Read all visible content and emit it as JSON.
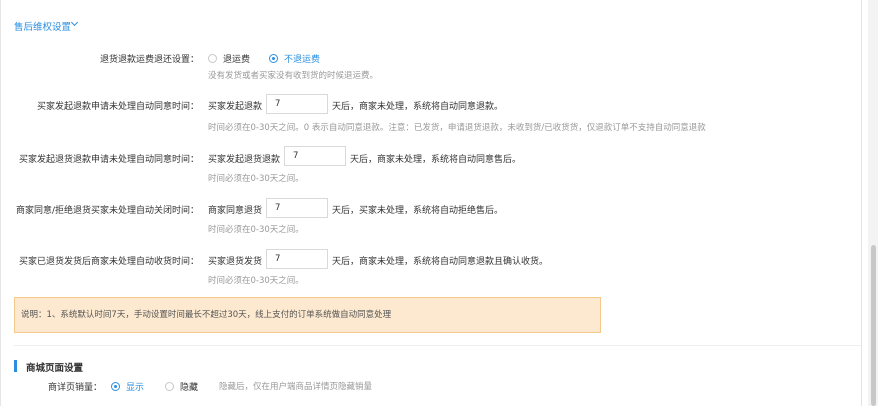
{
  "aftersale": {
    "section_title": "售后维权设置",
    "shipping_refund": {
      "label": "退货退款运费退还设置：",
      "options": [
        "退运费",
        "不退运费"
      ],
      "selected": "不退运费",
      "hint": "没有发货或者买家没有收到货的时候退运费。"
    },
    "refund_request": {
      "label": "买家发起退款申请未处理自动同意时间：",
      "prefix": "买家发起退款",
      "value": "7",
      "suffix": "天后，商家未处理，系统将自动同意退款。",
      "hint": "时间必须在0-30天之间。0 表示自动同意退款。注意：已发货，申请退货退款，未收到货/已收货货，仅退款订单不支持自动同意退款"
    },
    "return_request": {
      "label": "买家发起退货退款申请未处理自动同意时间：",
      "prefix": "买家发起退货退款",
      "value": "7",
      "suffix": "天后，商家未处理，系统将自动同意售后。",
      "hint": "时间必须在0-30天之间。"
    },
    "auto_close": {
      "label": "商家同意/拒绝退货买家未处理自动关闭时间：",
      "prefix": "商家同意退货",
      "value": "7",
      "suffix": "天后，买家未处理，系统将自动拒绝售后。",
      "hint": "时间必须在0-30天之间。"
    },
    "auto_receive": {
      "label": "买家已退货发货后商家未处理自动收货时间：",
      "prefix": "买家退货发货",
      "value": "7",
      "suffix": "天后，商家未处理，系统将自动同意退款且确认收货。",
      "hint": "时间必须在0-30天之间。"
    },
    "note": "说明：1、系统默认时间7天，手动设置时间最长不超过30天，线上支付的订单系统做自动同意处理"
  },
  "mall": {
    "section_title": "商城页面设置",
    "sales_volume": {
      "label": "商详页销量：",
      "options": [
        "显示",
        "隐藏"
      ],
      "selected": "显示",
      "hint": "隐藏后，仅在用户端商品详情页隐藏销量"
    }
  },
  "colors": {
    "accent": "#2a8fe0",
    "note_bg": "#fde9cf",
    "note_border": "#f3c98c",
    "hint": "#999999"
  }
}
